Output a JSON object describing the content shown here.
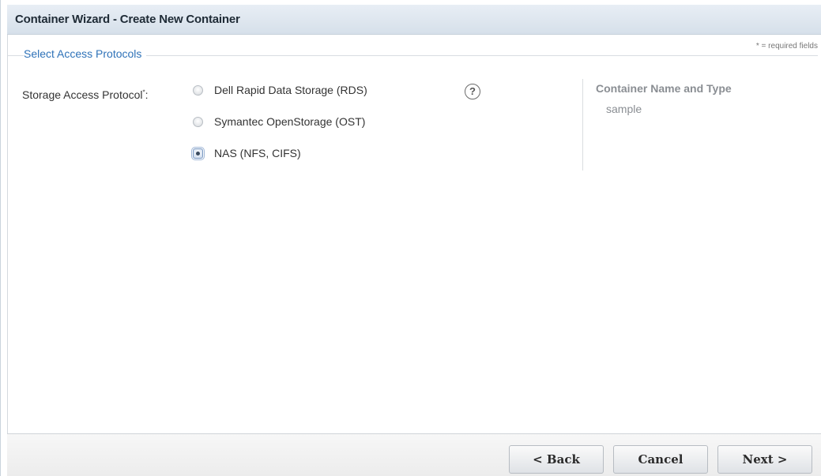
{
  "window": {
    "title": "Container Wizard - Create New Container"
  },
  "section": {
    "title": "Select Access Protocols",
    "required_note": "* = required fields"
  },
  "form": {
    "label": "Storage Access Protocol",
    "required_marker": "*",
    "label_suffix": ":",
    "options": [
      {
        "label": "Dell Rapid Data Storage (RDS)",
        "checked": false
      },
      {
        "label": "Symantec OpenStorage (OST)",
        "checked": false
      },
      {
        "label": "NAS (NFS, CIFS)",
        "checked": true
      }
    ],
    "help_icon": "question-circle-icon",
    "help_glyph": "?"
  },
  "summary": {
    "title": "Container Name and Type",
    "value": "sample"
  },
  "footer": {
    "back_label": "< Back",
    "cancel_label": "Cancel",
    "next_label": "Next >"
  }
}
